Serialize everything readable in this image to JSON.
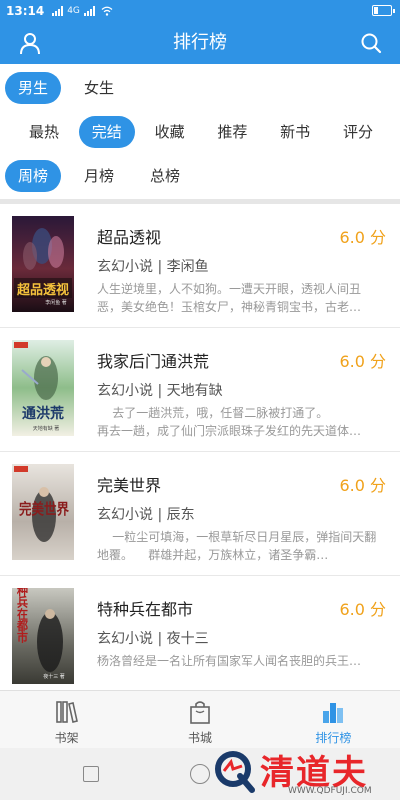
{
  "status_bar": {
    "time": "13:14",
    "network": "4G"
  },
  "header": {
    "title": "排行榜"
  },
  "gender_tabs": [
    {
      "label": "男生",
      "active": true
    },
    {
      "label": "女生",
      "active": false
    }
  ],
  "category_tabs": [
    {
      "label": "最热",
      "active": false
    },
    {
      "label": "完结",
      "active": true
    },
    {
      "label": "收藏",
      "active": false
    },
    {
      "label": "推荐",
      "active": false
    },
    {
      "label": "新书",
      "active": false
    },
    {
      "label": "评分",
      "active": false
    }
  ],
  "period_tabs": [
    {
      "label": "周榜",
      "active": true
    },
    {
      "label": "月榜",
      "active": false
    },
    {
      "label": "总榜",
      "active": false
    }
  ],
  "books": [
    {
      "title": "超品透视",
      "score": "6.0 分",
      "category": "玄幻小说 | 李闲鱼",
      "description": "人生逆境里，人不如狗。一遭天开眼，透视人间丑恶，美女绝色！玉棺女尸，神秘青铜宝书，古老…",
      "cover_text": "超品透视",
      "cover_sub": "李闲鱼 著"
    },
    {
      "title": "我家后门通洪荒",
      "score": "6.0 分",
      "category": "玄幻小说 | 天地有缺",
      "description": "    去了一趟洪荒，哦，任督二脉被打通了。\n再去一趟，成了仙门宗派眼珠子发红的先天道体…",
      "cover_text": "通洪荒",
      "cover_sub": "天地有缺 著"
    },
    {
      "title": "完美世界",
      "score": "6.0 分",
      "category": "玄幻小说 | 辰东",
      "description": "    一粒尘可填海，一根草斩尽日月星辰，弹指间天翻地覆。    群雄并起，万族林立，诸圣争霸…",
      "cover_text": "完美世界",
      "cover_sub": ""
    },
    {
      "title": "特种兵在都市",
      "score": "6.0 分",
      "category": "玄幻小说 | 夜十三",
      "description": "杨洛曾经是一名让所有国家军人闻名丧胆的兵王…",
      "cover_text": "特种兵在都市",
      "cover_sub": "夜十三 著"
    }
  ],
  "bottom_nav": [
    {
      "label": "书架",
      "icon": "books-icon",
      "active": false
    },
    {
      "label": "书城",
      "icon": "bag-icon",
      "active": false
    },
    {
      "label": "排行榜",
      "icon": "ranking-icon",
      "active": true
    }
  ],
  "watermark": {
    "text": "清道夫",
    "url": "WWW.QDFUJI.COM"
  },
  "colors": {
    "primary": "#2f93e5",
    "score": "#f0a21c",
    "watermark": "#e8262a"
  }
}
